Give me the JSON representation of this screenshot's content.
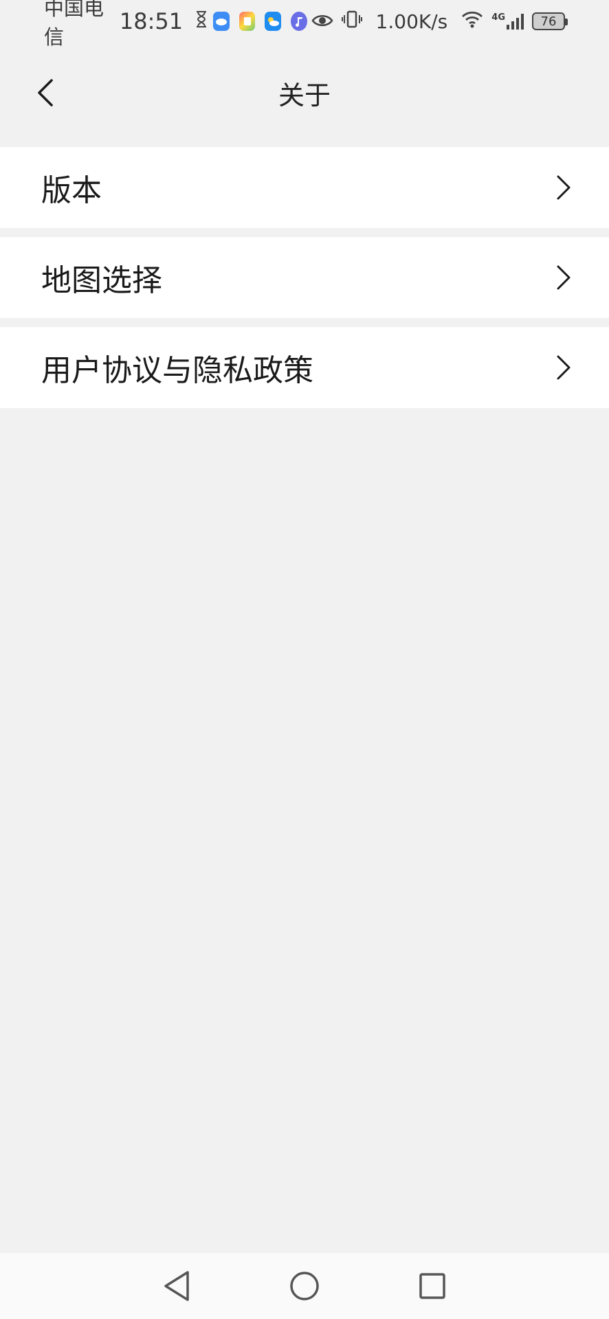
{
  "status_bar": {
    "carrier": "中国电信",
    "time": "18:51",
    "net_speed": "1.00K/s",
    "network_type": "4G",
    "battery": "76",
    "icons": [
      "hourglass-icon",
      "cloud-app-icon",
      "app-store-icon",
      "weather-app-icon",
      "music-app-icon",
      "eye-icon",
      "vibrate-icon",
      "wifi-icon",
      "signal-icon",
      "battery-icon"
    ]
  },
  "header": {
    "title": "关于",
    "back_icon": "chevron-left-icon"
  },
  "list": {
    "items": [
      {
        "label": "版本"
      },
      {
        "label": "地图选择"
      },
      {
        "label": "用户协议与隐私政策"
      }
    ]
  },
  "nav_bar": {
    "icons": [
      "back-triangle-icon",
      "home-circle-icon",
      "recents-square-icon"
    ]
  },
  "colors": {
    "background": "#f1f1f1",
    "card": "#ffffff",
    "text": "#1a1a1a"
  }
}
